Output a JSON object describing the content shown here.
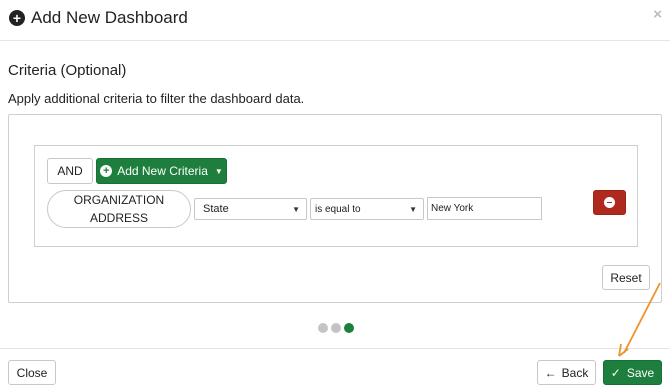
{
  "dialog": {
    "title": "Add New Dashboard",
    "close_symbol": "×"
  },
  "criteria": {
    "title": "Criteria (Optional)",
    "description": "Apply additional criteria to filter the dashboard data.",
    "and_label": "AND",
    "add_label": "Add New Criteria",
    "rule": {
      "field_label": "ORGANIZATION ADDRESS",
      "field_select": "State",
      "operator_select": "is equal to",
      "value": "New York"
    },
    "reset_label": "Reset"
  },
  "steps": {
    "total": 3,
    "current": 3
  },
  "footer": {
    "close_label": "Close",
    "back_label": "Back",
    "save_label": "Save"
  },
  "colors": {
    "primary_green": "#1e7e3e",
    "danger_red": "#b0291f",
    "annotation_orange": "#f0922b"
  }
}
